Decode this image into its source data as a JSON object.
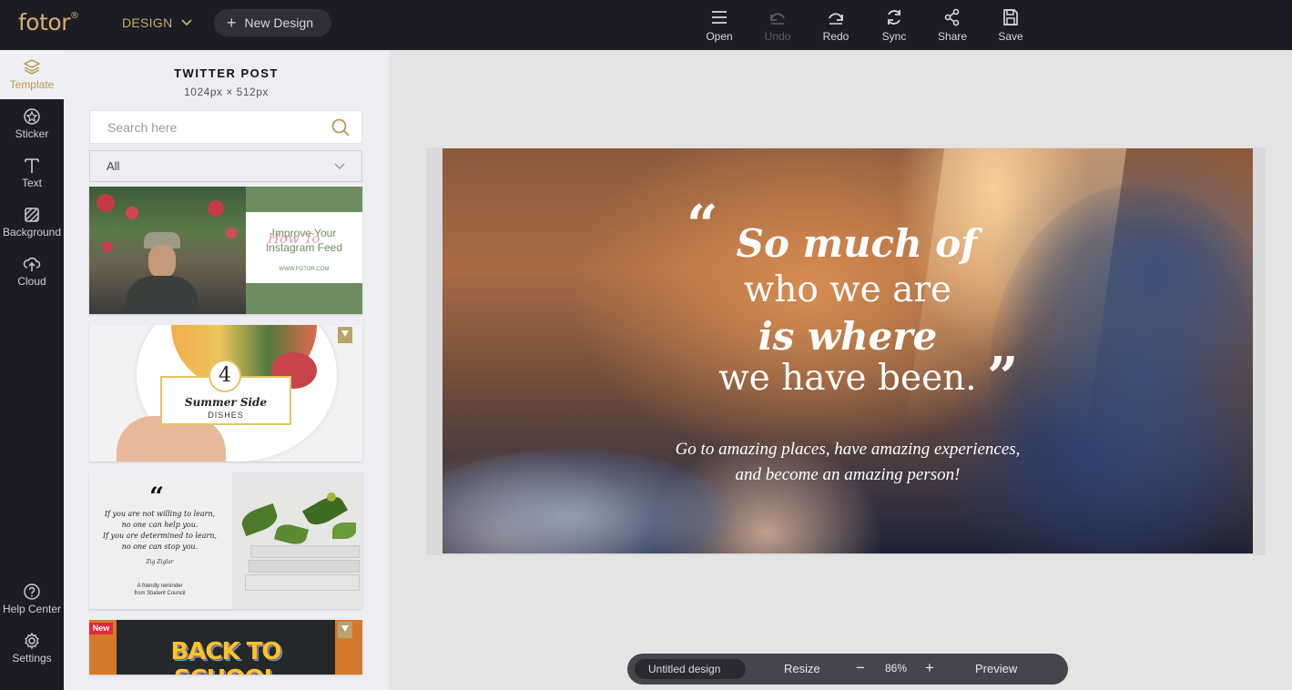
{
  "app": {
    "logo": "fotor",
    "logo_mark": "®",
    "design_menu": "DESIGN",
    "new_design": "New Design",
    "accent": "#d3b26e"
  },
  "toolbar": [
    {
      "label": "Open",
      "icon": "menu-icon",
      "enabled": true
    },
    {
      "label": "Undo",
      "icon": "undo-icon",
      "enabled": false
    },
    {
      "label": "Redo",
      "icon": "redo-icon",
      "enabled": true
    },
    {
      "label": "Sync",
      "icon": "sync-icon",
      "enabled": true
    },
    {
      "label": "Share",
      "icon": "share-icon",
      "enabled": true
    },
    {
      "label": "Save",
      "icon": "save-icon",
      "enabled": true
    }
  ],
  "rail": [
    {
      "label": "Template",
      "icon": "layers-icon",
      "active": true
    },
    {
      "label": "Sticker",
      "icon": "sticker-icon",
      "active": false
    },
    {
      "label": "Text",
      "icon": "text-icon",
      "active": false
    },
    {
      "label": "Background",
      "icon": "background-icon",
      "active": false
    },
    {
      "label": "Cloud",
      "icon": "cloud-icon",
      "active": false
    },
    {
      "label": "Help Center",
      "icon": "help-icon",
      "active": false
    },
    {
      "label": "Settings",
      "icon": "settings-icon",
      "active": false
    }
  ],
  "panel": {
    "title": "TWITTER POST",
    "size": "1024px × 512px",
    "search_placeholder": "Search here",
    "filter": "All"
  },
  "templates": {
    "t1": {
      "title_line1": "Improve Your",
      "title_line2": "Instagram Feed",
      "script": "How To",
      "url": "WWW.FOTOR.COM"
    },
    "t2": {
      "number": "4",
      "title": "Summer Side",
      "subtitle": "DISHES"
    },
    "t3": {
      "quote_lines": [
        "If you are not willing to learn,",
        "no one can help you.",
        "If you are determined to learn,",
        "no one can stop you."
      ],
      "author": "Zig Ziglar",
      "footer_lines": [
        "A friendly reminder",
        "from Student Council"
      ]
    },
    "t4": {
      "badge": "New",
      "title": "BACK TO SCHOOL"
    }
  },
  "canvas": {
    "open_quote": "“",
    "close_quote": "”",
    "line1": "So much of",
    "line2": "who we are",
    "line3": "is where",
    "line4": "we have been.",
    "sub1": "Go to amazing places, have amazing experiences,",
    "sub2": "and become an amazing person!"
  },
  "bottombar": {
    "doc_name": "Untitled design",
    "resize": "Resize",
    "zoom_out": "−",
    "zoom": "86%",
    "zoom_in": "+",
    "preview": "Preview"
  }
}
